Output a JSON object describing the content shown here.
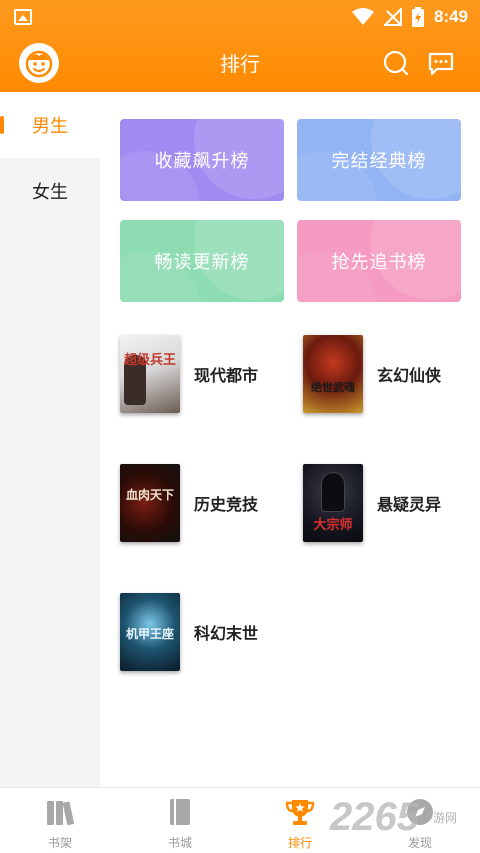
{
  "status_bar": {
    "time": "8:49"
  },
  "header": {
    "title": "排行"
  },
  "side_nav": {
    "items": [
      {
        "label": "男生"
      },
      {
        "label": "女生"
      }
    ]
  },
  "ranking_cards": [
    {
      "label": "收藏飙升榜",
      "color": "#a08cf0"
    },
    {
      "label": "完结经典榜",
      "color": "#93b4f4"
    },
    {
      "label": "畅读更新榜",
      "color": "#8edcb2"
    },
    {
      "label": "抢先追书榜",
      "color": "#f59ac0"
    }
  ],
  "categories": [
    {
      "label": "现代都市",
      "cover_text": "超级兵王"
    },
    {
      "label": "玄幻仙侠",
      "cover_text": "绝世武魂"
    },
    {
      "label": "历史竞技",
      "cover_text": "血肉天下"
    },
    {
      "label": "悬疑灵异",
      "cover_text": "大宗师"
    },
    {
      "label": "科幻末世",
      "cover_text": "机甲王座"
    }
  ],
  "bottom_nav": {
    "tabs": [
      {
        "label": "书架"
      },
      {
        "label": "书城"
      },
      {
        "label": "排行"
      },
      {
        "label": "发现"
      }
    ]
  },
  "watermark": {
    "number": "2265",
    "text": "手游网"
  },
  "colors": {
    "accent": "#ff8a00"
  }
}
